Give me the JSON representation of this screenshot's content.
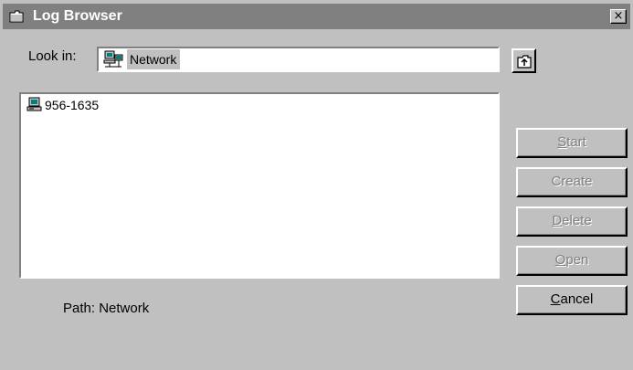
{
  "window": {
    "title": "Log Browser",
    "close_label": "×",
    "title_icon": "folder-icon"
  },
  "lookin": {
    "label": "Look in:",
    "value": "Network",
    "icon": "network-icon"
  },
  "up_button": {
    "icon": "up-one-level-icon"
  },
  "list": {
    "items": [
      {
        "label": "956-1635",
        "icon": "computer-icon"
      }
    ]
  },
  "path": {
    "text": "Path: Network"
  },
  "buttons": {
    "start": {
      "mnemonic": "S",
      "rest": "tart",
      "enabled": false
    },
    "create": {
      "mnemonic": "",
      "rest": "Create",
      "enabled": false
    },
    "delete": {
      "mnemonic": "D",
      "rest": "elete",
      "enabled": false
    },
    "open": {
      "mnemonic": "O",
      "rest": "pen",
      "enabled": false
    },
    "cancel": {
      "mnemonic": "C",
      "rest": "ancel",
      "enabled": true
    }
  },
  "colors": {
    "face": "#c0c0c0",
    "titlebar_inactive": "#808080",
    "disabled_text": "#808080"
  }
}
